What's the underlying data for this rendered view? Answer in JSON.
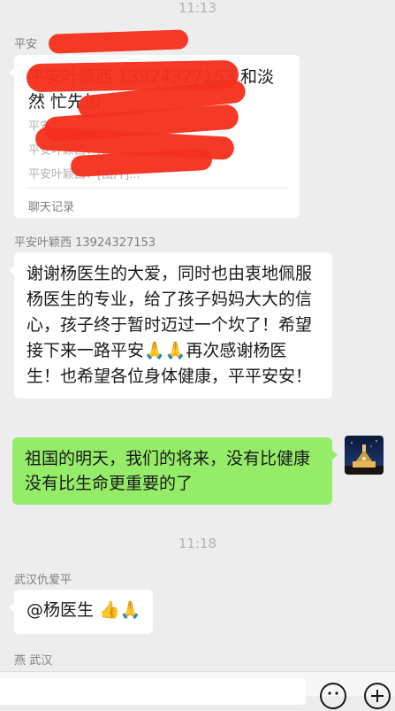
{
  "timestamps": {
    "first": "11:13",
    "second": "11:18"
  },
  "chat_record_message": {
    "sender": "平安",
    "title": "平安叶颖西 13924327153 和淡然 忙先加",
    "lines": [
      "平安叶颖西：[图片]",
      "平安叶颖西：[图片]",
      "平安叶颖西：[图片]..."
    ],
    "footer": "聊天记录"
  },
  "message_2": {
    "sender": "平安叶颖西 13924327153",
    "text": "谢谢杨医生的大爱，同时也由衷地佩服杨医生的专业，给了孩子妈妈大大的信心，孩子终于暂时迈过一个坎了！希望接下来一路平安🙏🙏再次感谢杨医生！也希望各位身体健康，平平安安！"
  },
  "message_3": {
    "text": "祖国的明天，我们的将来，没有比健康没有比生命更重要的了"
  },
  "message_4": {
    "sender": "武汉仇爱平",
    "text": "@杨医生 👍🙏"
  },
  "next_sender": "燕  武汉",
  "colors": {
    "background": "#ededed",
    "self_bubble": "#95ec69",
    "other_bubble": "#ffffff",
    "redaction": "#f4311e"
  }
}
